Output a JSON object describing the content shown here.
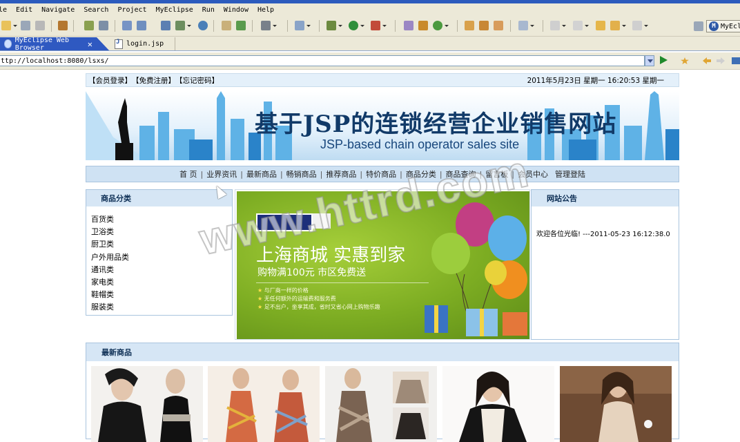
{
  "ide": {
    "menu": [
      "le",
      "Edit",
      "Navigate",
      "Search",
      "Project",
      "MyEclipse",
      "Run",
      "Window",
      "Help"
    ],
    "perspective_label": "MyEcli",
    "tabs": {
      "active": "MyEclipse Web Browser",
      "inactive": "login.jsp"
    },
    "url": "ttp://localhost:8080/lsxs/"
  },
  "site": {
    "top_links": [
      "【会员登录】",
      "【免费注册】",
      "【忘记密码】"
    ],
    "datetime": "2011年5月23日  星期一  16:20:53   星期一",
    "banner_title": "基于JSP的连锁经营企业销售网站",
    "banner_subtitle": "JSP-based chain operator sales site",
    "nav": [
      "首 页",
      "业界资讯",
      "最新商品",
      "畅销商品",
      "推荐商品",
      "特价商品",
      "商品分类",
      "商品查询",
      "留言板",
      "会员中心",
      "管理登陆"
    ],
    "category_title": "商品分类",
    "categories": [
      "百货类",
      "卫浴类",
      "厨卫类",
      "户外用品类",
      "通讯类",
      "家电类",
      "鞋帽类",
      "服装类"
    ],
    "ad": {
      "title": "上海商城 实惠到家",
      "subtitle": "购物满100元 市区免费送",
      "bullets": [
        "与厂商一样的价格",
        "无任何额外的运输费和服务费",
        "足不出户，坐享其成，省时又省心网上购物乐趣"
      ]
    },
    "notice_title": "网站公告",
    "notice_text": "欢迎各位光临! ---2011-05-23 16:12:38.0",
    "newest_title": "最新商品"
  },
  "watermark": "www.httrd.com",
  "colors": {
    "ide_bg": "#ece9d8",
    "tab_active": "#2f59c1",
    "page_header_bg": "#d6e6f5",
    "banner_title": "#113a68",
    "ad_green": "#7cac22"
  }
}
